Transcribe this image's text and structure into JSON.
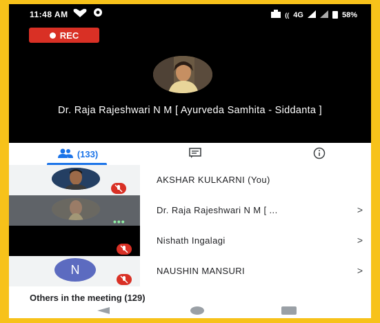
{
  "status_bar": {
    "time": "11:48 AM",
    "network": "4G",
    "battery": "58%"
  },
  "recording": {
    "label": "REC"
  },
  "presenter": {
    "name": "Dr. Raja Rajeshwari N M [ Ayurveda Samhita - Siddanta ]"
  },
  "tabs": {
    "people_count": "(133)",
    "chat": "chat-icon",
    "info": "info-icon"
  },
  "participants": [
    {
      "name": "AKSHAR KULKARNI (You)",
      "muted": true,
      "chevron": ""
    },
    {
      "name": "Dr. Raja Rajeshwari N M [ ...",
      "muted": false,
      "chevron": ">"
    },
    {
      "name": "Nishath Ingalagi",
      "muted": true,
      "chevron": ">"
    },
    {
      "name": "NAUSHIN MANSURI",
      "muted": true,
      "chevron": ">",
      "initial": "N"
    }
  ],
  "others": {
    "label": "Others in the meeting (129)"
  },
  "colors": {
    "frame": "#f7c21a",
    "accent": "#1a73e8",
    "mute": "#d93025",
    "avatar_n": "#5c6bc0"
  }
}
